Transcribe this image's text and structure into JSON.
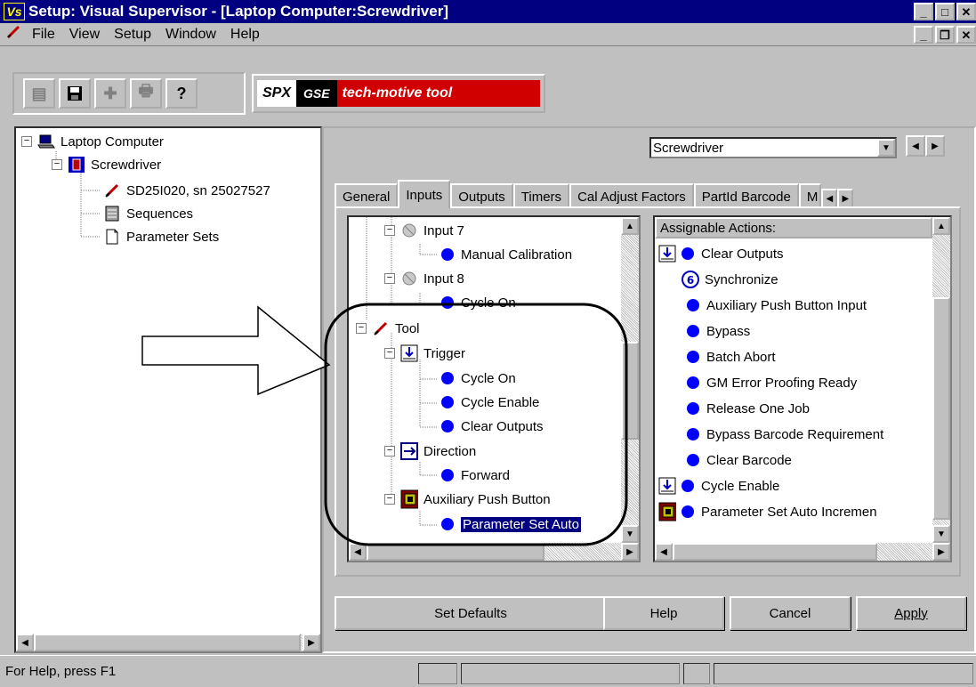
{
  "window": {
    "icon_text": "Vs",
    "title": "Setup: Visual Supervisor - [Laptop Computer:Screwdriver]"
  },
  "menu": {
    "items": [
      "File",
      "View",
      "Setup",
      "Window",
      "Help"
    ]
  },
  "toolbar": {
    "logo_spx": "SPX",
    "logo_gse": "GSE",
    "logo_tagline": "tech-motive tool"
  },
  "left_tree": {
    "items": [
      {
        "label": "Laptop Computer",
        "icon": "laptop-icon"
      },
      {
        "label": "Screwdriver",
        "icon": "screwdriver-icon"
      },
      {
        "label": "SD25I020, sn 25027527",
        "icon": "tool-icon"
      },
      {
        "label": "Sequences",
        "icon": "sequences-icon"
      },
      {
        "label": "Parameter Sets",
        "icon": "document-icon"
      }
    ]
  },
  "right": {
    "combo_value": "Screwdriver",
    "tabs": [
      "General",
      "Inputs",
      "Outputs",
      "Timers",
      "Cal Adjust Factors",
      "PartId Barcode",
      "M"
    ],
    "active_tab": "Inputs",
    "inputs_tree": [
      {
        "label": "Input 7",
        "level": 1
      },
      {
        "label": "Manual Calibration",
        "level": 2
      },
      {
        "label": "Input 8",
        "level": 1
      },
      {
        "label": "Cycle On",
        "level": 2
      },
      {
        "label": "Tool",
        "level": 0
      },
      {
        "label": "Trigger",
        "level": 1
      },
      {
        "label": "Cycle On",
        "level": 2
      },
      {
        "label": "Cycle Enable",
        "level": 2
      },
      {
        "label": "Clear Outputs",
        "level": 2
      },
      {
        "label": "Direction",
        "level": 1
      },
      {
        "label": "Forward",
        "level": 2
      },
      {
        "label": "Auxiliary Push Button",
        "level": 1
      },
      {
        "label": "Parameter Set  Auto",
        "level": 2,
        "selected": true
      }
    ],
    "actions_header": "Assignable Actions:",
    "actions": [
      "Clear Outputs",
      "Synchronize",
      "Auxiliary Push Button Input",
      "Bypass",
      "Batch Abort",
      "GM Error Proofing Ready",
      "Release One Job",
      "Bypass Barcode Requirement",
      "Clear Barcode",
      "Cycle Enable",
      "Parameter Set  Auto Incremen"
    ],
    "buttons": {
      "set_defaults": "Set Defaults",
      "help": "Help",
      "cancel": "Cancel",
      "apply": "Apply"
    }
  },
  "status": {
    "text": "For Help, press F1"
  },
  "colors": {
    "title_bar": "#000080",
    "bullet": "#0000ff",
    "selection": "#000080"
  }
}
